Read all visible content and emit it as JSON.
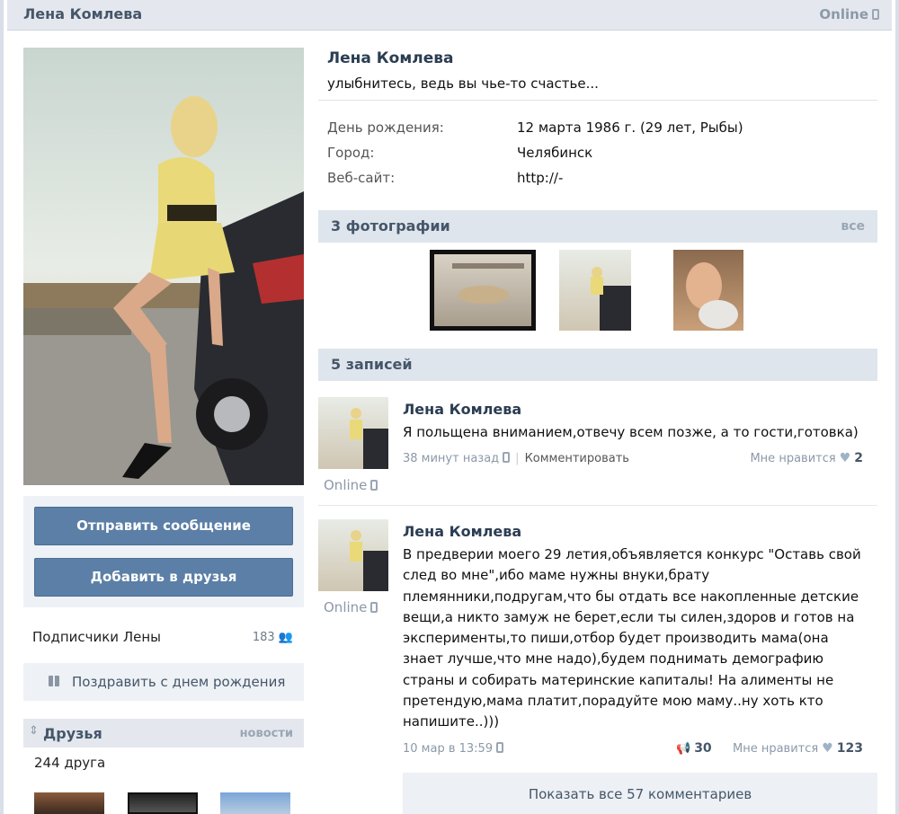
{
  "header": {
    "name": "Лена Комлева",
    "online": "Online"
  },
  "profile": {
    "name": "Лена Комлева",
    "status": "улыбнитесь, ведь вы чье-то счастье...",
    "info": [
      {
        "label": "День рождения:",
        "value": "12 марта 1986 г. (29 лет, Рыбы)"
      },
      {
        "label": "Город:",
        "value": "Челябинск"
      },
      {
        "label": "Веб-сайт:",
        "value": "http://-"
      }
    ]
  },
  "actions": {
    "send_message": "Отправить сообщение",
    "add_friend": "Добавить в друзья"
  },
  "subscribers": {
    "label": "Подписчики Лены",
    "count": "183"
  },
  "birthday": {
    "label": "Поздравить с днем рождения"
  },
  "friends": {
    "title": "Друзья",
    "news": "новости",
    "count": "244 друга"
  },
  "photos": {
    "title": "3 фотографии",
    "all": "все"
  },
  "wall": {
    "title": "5 записей",
    "posts": [
      {
        "author": "Лена Комлева",
        "online": "Online",
        "text": "Я польщена вниманием,отвечу всем позже, а то гости,готовка)",
        "time": "38 минут назад",
        "comment": "Комментировать",
        "likes_label": "Мне нравится",
        "likes": "2"
      },
      {
        "author": "Лена Комлева",
        "online": "Online",
        "text_lines": [
          "В предверии моего 29 летия,объявляется конкурс \"Оставь свой",
          "след во мне\",ибо маме нужны внуки,брату",
          "племянники,подругам,что бы отдать все накопленные детские",
          "вещи,а никто замуж не берет,если ты силен,здоров и готов на",
          "эксперименты,то пиши,отбор будет производить мама(она",
          "знает лучше,что мне надо),будем поднимать демографию",
          "страны и собирать материнские капиталы! На алименты не",
          "претендую,мама платит,порадуйте мою маму..ну хоть кто",
          "напишите..)))"
        ],
        "time": "10 мар в 13:59",
        "shares": "30",
        "likes_label": "Мне нравится",
        "likes": "123",
        "show_all": "Показать все 57 комментариев"
      }
    ]
  },
  "colors": {
    "accent": "#5b7fa6",
    "header_bg": "#e4e8ee",
    "section_bg": "#dfe5ec",
    "text_blue": "#2b3d52"
  }
}
